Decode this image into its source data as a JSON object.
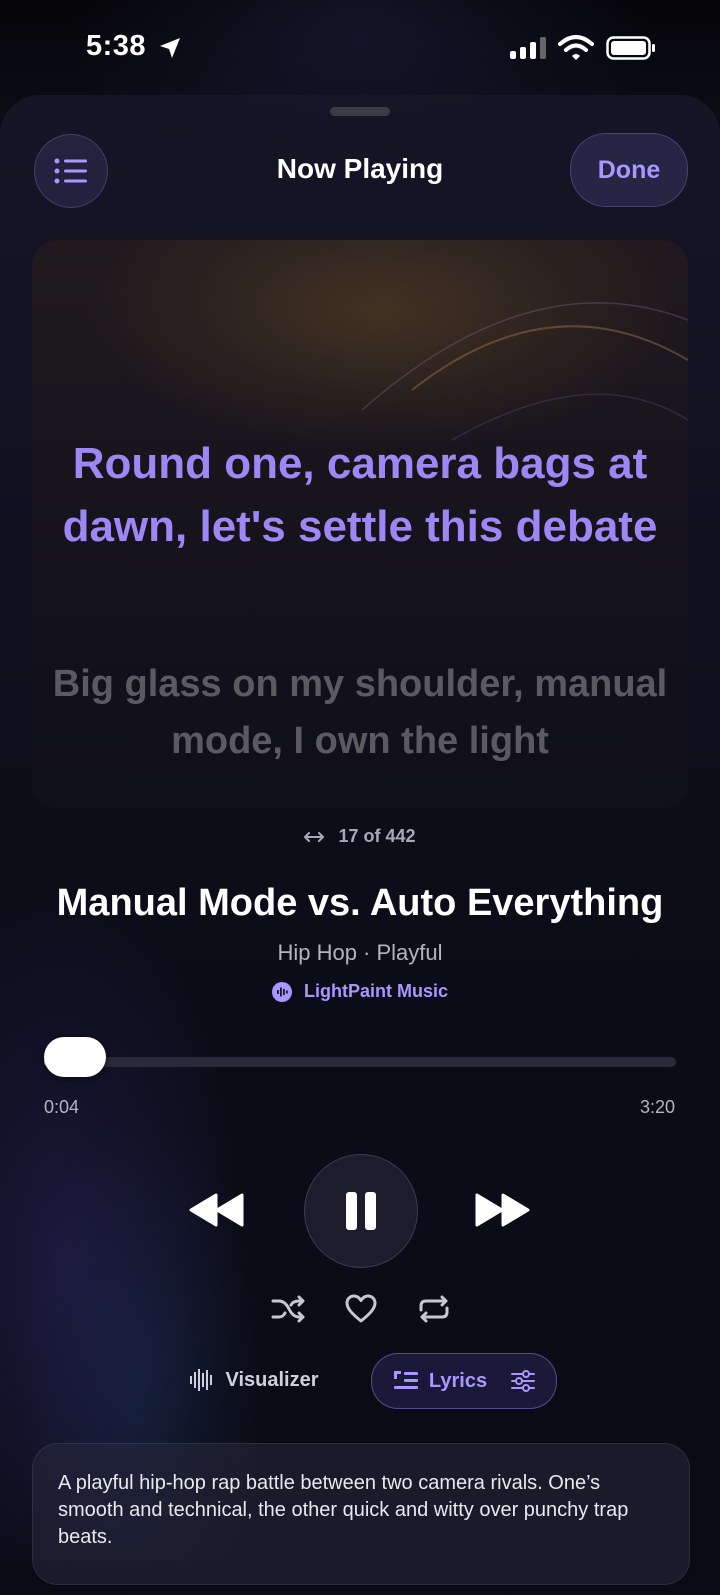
{
  "status_bar": {
    "time": "5:38"
  },
  "header": {
    "title": "Now Playing",
    "done_label": "Done"
  },
  "lyrics": {
    "active_line": "Round one, camera bags at dawn, let's settle this debate",
    "next_line": "Big glass on my shoulder, manual mode, I own the light"
  },
  "counter": {
    "text": "17 of 442"
  },
  "track": {
    "title": "Manual Mode vs. Auto Everything",
    "meta": "Hip Hop · Playful",
    "artist": "LightPaint Music"
  },
  "progress": {
    "elapsed": "0:04",
    "total": "3:20",
    "fraction": 0.02
  },
  "modes": {
    "visualizer_label": "Visualizer",
    "lyrics_label": "Lyrics"
  },
  "description": "A playful hip-hop rap battle between two camera rivals. One’s smooth and technical, the other quick and witty over punchy trap beats.",
  "colors": {
    "accent": "#9d87f5",
    "background": "#0a0a14"
  },
  "icons": [
    "location-arrow-icon",
    "signal-icon",
    "wifi-icon",
    "battery-icon",
    "queue-list-icon",
    "swap-arrows-icon",
    "waveform-icon",
    "rewind-icon",
    "pause-icon",
    "fast-forward-icon",
    "shuffle-icon",
    "heart-icon",
    "repeat-icon",
    "visualizer-icon",
    "lyrics-icon",
    "sliders-icon"
  ]
}
